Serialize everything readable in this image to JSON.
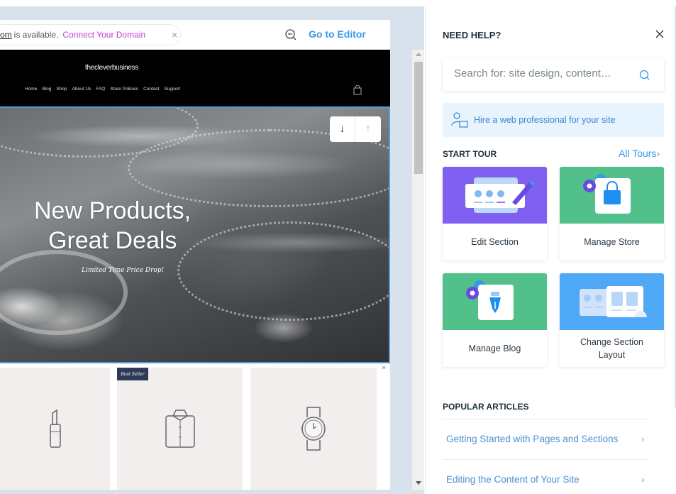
{
  "preview": {
    "notice": {
      "domain_fragment": "om",
      "availability_text": "is available.",
      "connect_link": "Connect Your Domain",
      "close_glyph": "×"
    },
    "zoom_icon": "zoom-out-icon",
    "goto_editor": "Go to Editor",
    "site": {
      "logo": "thecleverbusiness",
      "nav": [
        "Home",
        "Blog",
        "Shop",
        "About Us",
        "FAQ",
        "Store Policies",
        "Contact",
        "Support"
      ],
      "cart_icon": "shopping-bag-icon"
    },
    "hero": {
      "title_line1": "New Products,",
      "title_line2": "Great Deals",
      "subtitle": "Limited Time Price Drop!",
      "move_down": "↓",
      "move_up": "↑"
    },
    "products": {
      "badge": "Best Seller",
      "items": [
        {
          "icon": "lipstick-icon"
        },
        {
          "icon": "shirt-icon"
        },
        {
          "icon": "watch-icon"
        }
      ],
      "next_glyph": "»"
    }
  },
  "help": {
    "title": "NEED HELP?",
    "search_placeholder": "Search for: site design, content…",
    "hire_text": "Hire a web professional for your site",
    "start_tour": "START TOUR",
    "all_tours": "All Tours",
    "all_tours_chevron": "›",
    "tours": [
      {
        "label": "Edit Section",
        "color": "#8060f0"
      },
      {
        "label": "Manage Store",
        "color": "#52c08a"
      },
      {
        "label": "Manage Blog",
        "color": "#52c08a"
      },
      {
        "label": "Change Section Layout",
        "color": "#4ea8f5"
      }
    ],
    "popular_articles": "POPULAR ARTICLES",
    "articles": [
      {
        "title": "Getting Started with Pages and Sections",
        "chevron": "›"
      },
      {
        "title": "Editing the Content of Your Site",
        "chevron": "›"
      }
    ]
  },
  "colors": {
    "accent_blue": "#3899ec",
    "connect_pink": "#c03ed4",
    "canvas_bg": "#d8e2ec",
    "hero_border": "#5a9ad6",
    "badge_navy": "#2f3a58"
  }
}
